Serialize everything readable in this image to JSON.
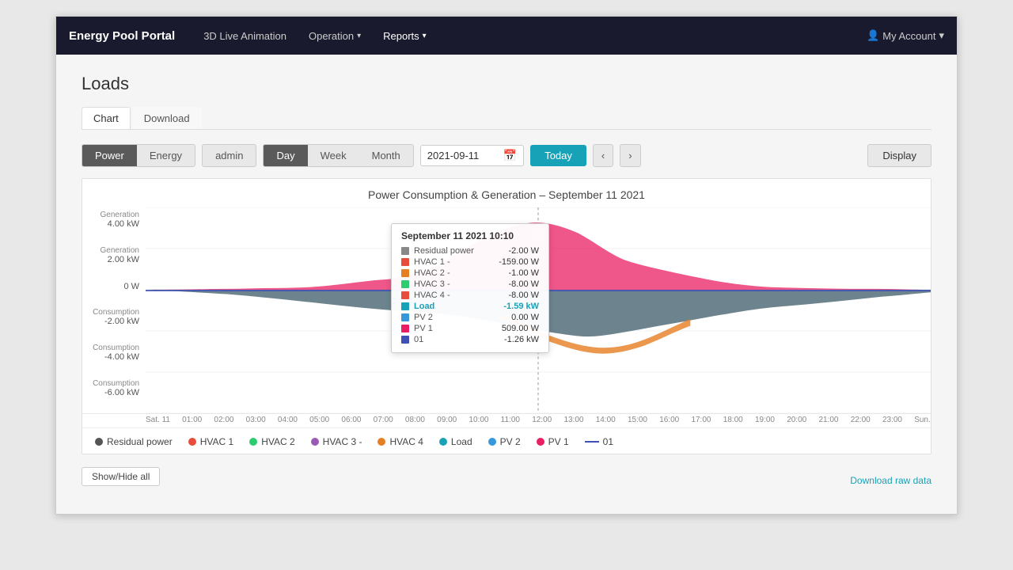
{
  "app": {
    "brand": "Energy Pool Portal",
    "nav_items": [
      {
        "label": "3D Live Animation",
        "has_dropdown": false
      },
      {
        "label": "Operation",
        "has_dropdown": true
      },
      {
        "label": "Reports",
        "has_dropdown": true,
        "active": true
      }
    ],
    "account_label": "My Account"
  },
  "page": {
    "title": "Loads",
    "tabs": [
      {
        "label": "Chart",
        "active": true
      },
      {
        "label": "Download",
        "active": false
      }
    ]
  },
  "toolbar": {
    "power_label": "Power",
    "energy_label": "Energy",
    "admin_label": "admin",
    "day_label": "Day",
    "week_label": "Week",
    "month_label": "Month",
    "date_value": "2021-09-11",
    "today_label": "Today",
    "prev_label": "‹",
    "next_label": "›",
    "display_label": "Display"
  },
  "chart": {
    "title": "Power Consumption & Generation – September 11 2021",
    "y_labels": [
      {
        "category": "Generation",
        "value": "4.00 kW"
      },
      {
        "category": "Generation",
        "value": "2.00 kW"
      },
      {
        "category": "",
        "value": "0 W"
      },
      {
        "category": "Consumption",
        "value": "-2.00 kW"
      },
      {
        "category": "Consumption",
        "value": "-4.00 kW"
      },
      {
        "category": "Consumption",
        "value": "-6.00 kW"
      }
    ],
    "x_labels": [
      "Sat. 11",
      "01:00",
      "02:00",
      "03:00",
      "04:00",
      "05:00",
      "06:00",
      "07:00",
      "08:00",
      "09:00",
      "10:00",
      "11:00",
      "12:00",
      "13:00",
      "14:00",
      "15:00",
      "16:00",
      "17:00",
      "18:00",
      "19:00",
      "20:00",
      "21:00",
      "22:00",
      "23:00",
      "Sun."
    ],
    "tooltip": {
      "title": "September 11 2021 10:10",
      "rows": [
        {
          "color": "#888",
          "label": "Residual power",
          "value": "-2.00 W"
        },
        {
          "color": "#e74c3c",
          "label": "HVAC 1 -",
          "value": "-159.00 W"
        },
        {
          "color": "#e67e22",
          "label": "HVAC 2 -",
          "value": "-1.00 W"
        },
        {
          "color": "#2ecc71",
          "label": "HVAC 3 -",
          "value": "-8.00 W"
        },
        {
          "color": "#e74c3c",
          "label": "HVAC 4 -",
          "value": "-8.00 W"
        },
        {
          "color": "#17a2b8",
          "label": "Load",
          "value": "-1.59 kW",
          "highlight": true
        },
        {
          "color": "#3498db",
          "label": "PV 2",
          "value": "0.00 W"
        },
        {
          "color": "#e91e63",
          "label": "PV 1",
          "value": "509.00 W"
        },
        {
          "color": "#3f51b5",
          "label": "01",
          "value": "-1.26 kW"
        }
      ]
    },
    "legend": [
      {
        "type": "dot",
        "color": "#555",
        "label": "Residual power"
      },
      {
        "type": "dot",
        "color": "#e74c3c",
        "label": "HVAC 1"
      },
      {
        "type": "dot",
        "color": "#2ecc71",
        "label": "HVAC 2"
      },
      {
        "type": "dot",
        "color": "#9b59b6",
        "label": "HVAC 3 -"
      },
      {
        "type": "dot",
        "color": "#e67e22",
        "label": "HVAC 4"
      },
      {
        "type": "dot",
        "color": "#17a2b8",
        "label": "Load"
      },
      {
        "type": "dot",
        "color": "#3498db",
        "label": "PV 2"
      },
      {
        "type": "dot",
        "color": "#e91e63",
        "label": "PV 1"
      },
      {
        "type": "line",
        "color": "#3f51b5",
        "label": "01"
      }
    ]
  },
  "footer": {
    "show_hide_label": "Show/Hide all",
    "download_label": "Download raw data"
  }
}
